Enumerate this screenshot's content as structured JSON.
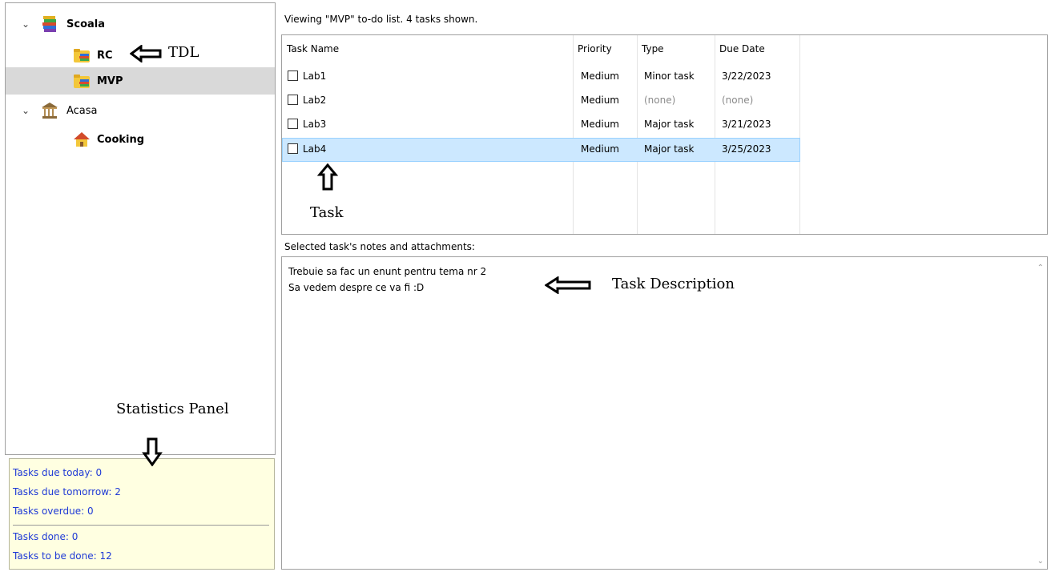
{
  "tree": {
    "items": [
      {
        "label": "Scoala",
        "icon": "books-icon"
      },
      {
        "label": "RC",
        "icon": "folder-books-icon"
      },
      {
        "label": "MVP",
        "icon": "folder-books-icon",
        "selected": true
      },
      {
        "label": "Acasa",
        "icon": "bank-building-icon"
      },
      {
        "label": "Cooking",
        "icon": "house-icon"
      }
    ]
  },
  "stats": {
    "due_today": "Tasks due today: 0",
    "due_tomorrow": "Tasks due tomorrow: 2",
    "overdue": "Tasks overdue: 0",
    "done": "Tasks done: 0",
    "to_be_done": "Tasks to be done: 12"
  },
  "view_header": "Viewing \"MVP\" to-do list. 4 tasks shown.",
  "task_table": {
    "columns": [
      "Task Name",
      "Priority",
      "Type",
      "Due Date"
    ],
    "rows": [
      {
        "name": "Lab1",
        "priority": "Medium",
        "type": "Minor task",
        "due": "3/22/2023"
      },
      {
        "name": "Lab2",
        "priority": "Medium",
        "type": "(none)",
        "due": "(none)"
      },
      {
        "name": "Lab3",
        "priority": "Medium",
        "type": "Major task",
        "due": "3/21/2023"
      },
      {
        "name": "Lab4",
        "priority": "Medium",
        "type": "Major task",
        "due": "3/25/2023",
        "selected": true
      }
    ]
  },
  "notes": {
    "header": "Selected task's notes and attachments:",
    "lines": [
      "Trebuie sa fac un enunt pentru tema nr 2",
      "Sa vedem despre ce va fi :D"
    ]
  },
  "annotations": {
    "tdl": "TDL",
    "task": "Task",
    "task_description": "Task Description",
    "statistics_panel": "Statistics Panel"
  },
  "colors": {
    "selection": "#cce8ff",
    "tree_selection": "#d9d9d9",
    "stats_background": "#ffffe1",
    "stats_text": "#1f3ad6"
  }
}
